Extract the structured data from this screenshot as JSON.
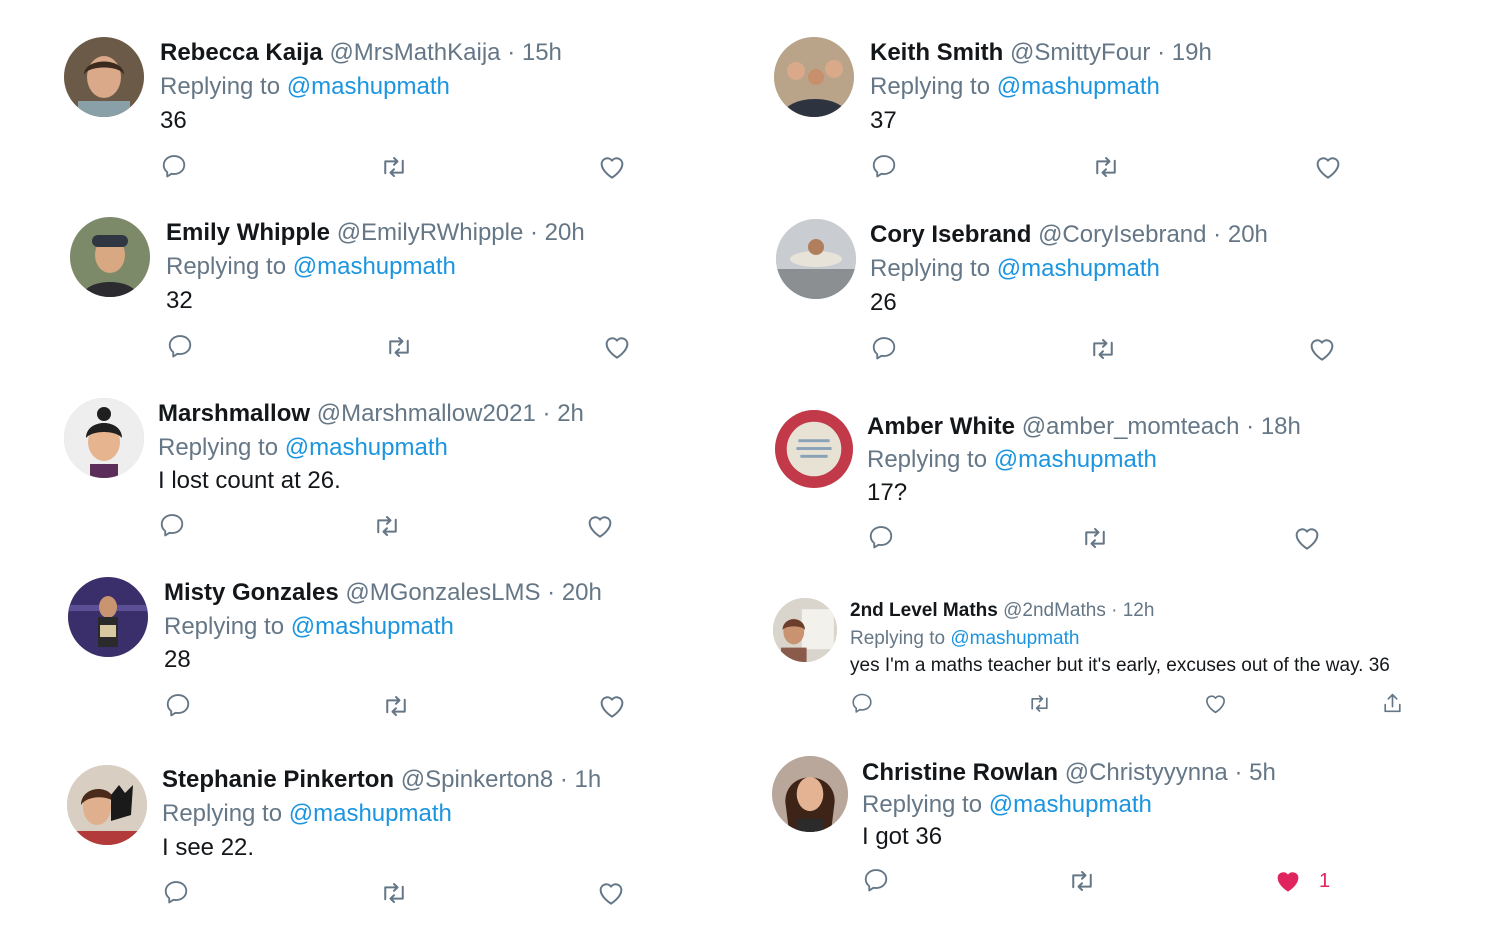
{
  "reply_prefix": "Replying to",
  "colors": {
    "mention": "#1b95e0",
    "muted": "#657786",
    "like_active": "#e0245e"
  },
  "icons": {
    "reply": "reply-icon",
    "retweet": "retweet-icon",
    "like": "heart-icon",
    "share": "share-icon"
  },
  "tweets": [
    {
      "name": "Rebecca Kaija",
      "handle": "@MrsMathKaija",
      "time": "15h",
      "mention": "@mashupmath",
      "text": "36"
    },
    {
      "name": "Emily Whipple",
      "handle": "@EmilyRWhipple",
      "time": "20h",
      "mention": "@mashupmath",
      "text": "32"
    },
    {
      "name": "Marshmallow",
      "handle": "@Marshmallow2021",
      "time": "2h",
      "mention": "@mashupmath",
      "text": "I lost count at 26."
    },
    {
      "name": "Misty Gonzales",
      "handle": "@MGonzalesLMS",
      "time": "20h",
      "mention": "@mashupmath",
      "text": "28"
    },
    {
      "name": "Stephanie Pinkerton",
      "handle": "@Spinkerton8",
      "time": "1h",
      "mention": "@mashupmath",
      "text": "I see 22."
    },
    {
      "name": "Keith Smith",
      "handle": "@SmittyFour",
      "time": "19h",
      "mention": "@mashupmath",
      "text": "37"
    },
    {
      "name": "Cory Isebrand",
      "handle": "@CoryIsebrand",
      "time": "20h",
      "mention": "@mashupmath",
      "text": "26"
    },
    {
      "name": "Amber White",
      "handle": "@amber_momteach",
      "time": "18h",
      "mention": "@mashupmath",
      "text": "17?"
    },
    {
      "name": "2nd Level Maths",
      "handle": "@2ndMaths",
      "time": "12h",
      "mention": "@mashupmath",
      "text": "yes I'm a maths teacher but it's early, excuses out of the way. 36"
    },
    {
      "name": "Christine Rowlan",
      "handle": "@Christyyynna",
      "time": "5h",
      "mention": "@mashupmath",
      "text": "I got 36",
      "likes": "1"
    }
  ]
}
